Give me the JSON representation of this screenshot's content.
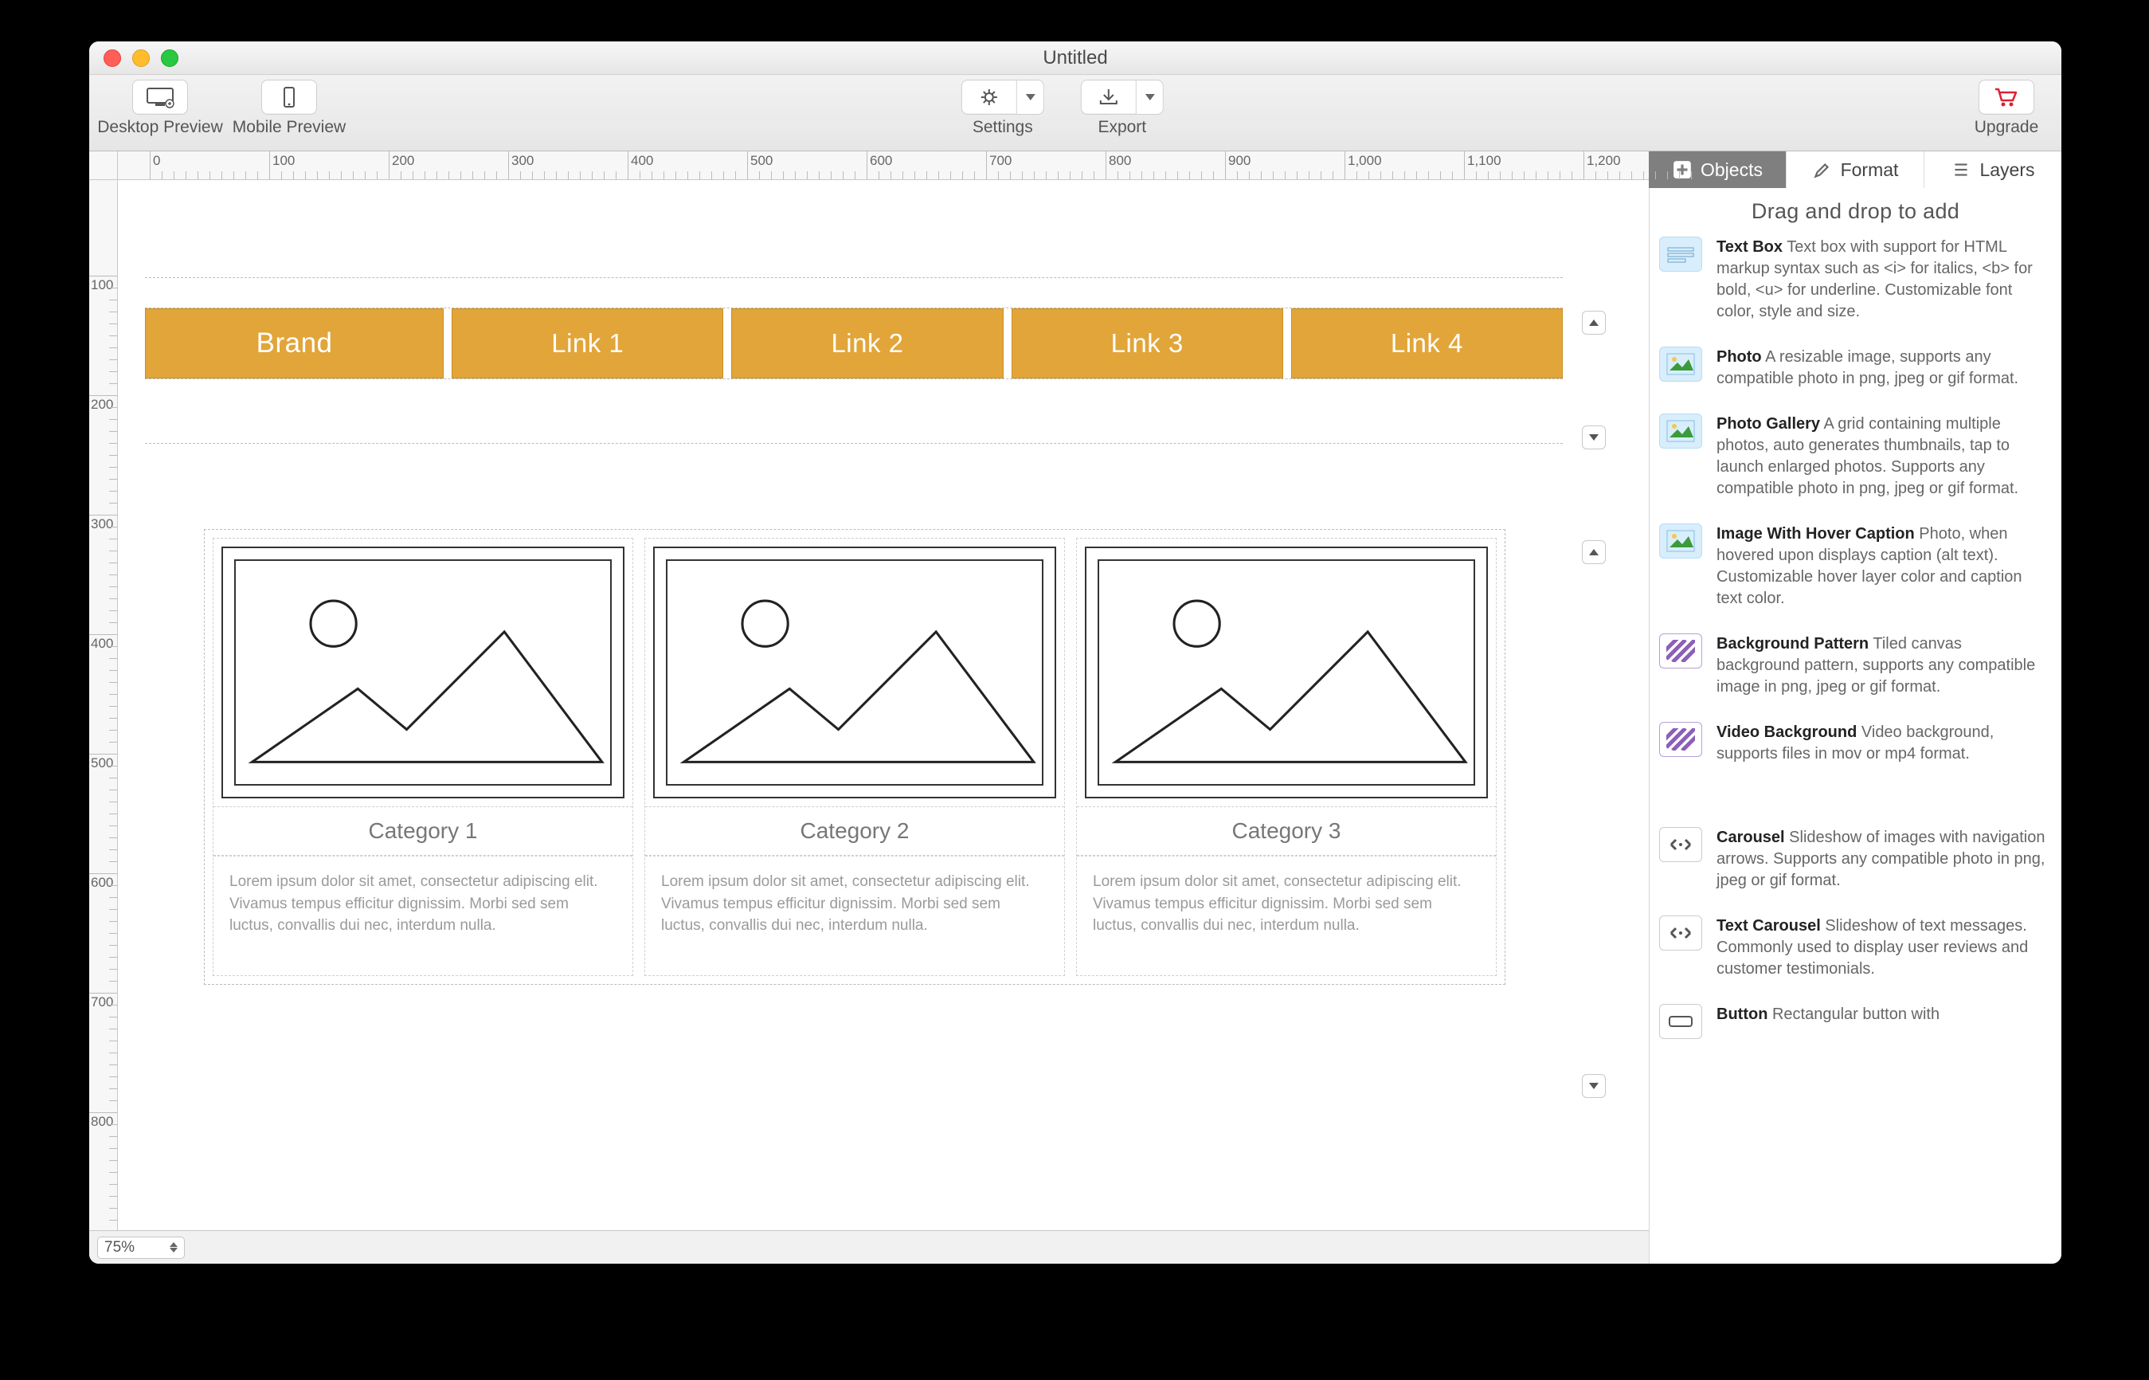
{
  "window_title": "Untitled",
  "toolbar": {
    "desktop_preview": "Desktop Preview",
    "mobile_preview": "Mobile Preview",
    "settings": "Settings",
    "export": "Export",
    "upgrade": "Upgrade"
  },
  "inspector_tabs": {
    "objects": "Objects",
    "format": "Format",
    "layers": "Layers"
  },
  "inspector_hint": "Drag and drop to add",
  "zoom": "75%",
  "rulers": {
    "h": [
      "0",
      "100",
      "200",
      "300",
      "400",
      "500",
      "600",
      "700",
      "800",
      "900",
      "1,000",
      "1,100",
      "1,200"
    ],
    "v": [
      "100",
      "200",
      "300",
      "400",
      "500",
      "600",
      "700",
      "800"
    ]
  },
  "nav": {
    "brand": "Brand",
    "links": [
      "Link 1",
      "Link 2",
      "Link 3",
      "Link 4"
    ]
  },
  "lorem": "Lorem ipsum dolor sit amet, consectetur adipiscing elit. Vivamus tempus efficitur dignissim. Morbi sed sem luctus, convallis dui nec, interdum nulla.",
  "categories": [
    {
      "title": "Category 1"
    },
    {
      "title": "Category 2"
    },
    {
      "title": "Category 3"
    }
  ],
  "objects": [
    {
      "name": "Text Box",
      "desc": "Text box with support for HTML markup syntax such as <i> for italics, <b> for bold, <u> for underline. Customizable font color, style and size."
    },
    {
      "name": "Photo",
      "desc": "A resizable image, supports any compatible photo in png, jpeg or gif format."
    },
    {
      "name": "Photo Gallery",
      "desc": "A grid containing multiple photos, auto generates thumbnails, tap to launch enlarged photos. Supports any compatible photo in png, jpeg or gif format."
    },
    {
      "name": "Image With Hover Caption",
      "desc": "Photo, when hovered upon displays caption (alt text). Customizable hover layer color and caption text color."
    },
    {
      "name": "Background Pattern",
      "desc": "Tiled canvas background pattern, supports any compatible image in png, jpeg or gif format."
    },
    {
      "name": "Video Background",
      "desc": "Video background, supports files in mov or mp4 format."
    },
    {
      "name": "Carousel",
      "desc": "Slideshow of images with navigation arrows.  Supports any compatible photo in png, jpeg or gif format."
    },
    {
      "name": "Text Carousel",
      "desc": "Slideshow of text messages.  Commonly used to display user reviews and customer testimonials."
    },
    {
      "name": "Button",
      "desc": "Rectangular button with"
    }
  ],
  "colors": {
    "accent": "#e2a539"
  }
}
